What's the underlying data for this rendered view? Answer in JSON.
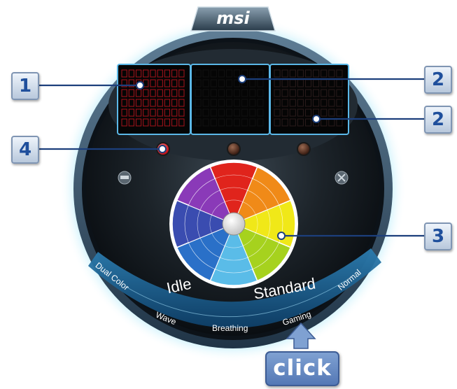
{
  "header": {
    "logo_text": "msi"
  },
  "keyboard_panels": [
    {
      "name": "left",
      "color": "#a8141c"
    },
    {
      "name": "middle",
      "color": "#111111"
    },
    {
      "name": "right",
      "color": "#2a1c1c"
    }
  ],
  "zone_indicators": [
    {
      "color": "#e5141c",
      "state": "active"
    },
    {
      "color": "#5a3020",
      "state": "inactive"
    },
    {
      "color": "#5a3020",
      "state": "inactive"
    }
  ],
  "side_icons": {
    "left": "keyboard-icon",
    "right": "close-icon"
  },
  "color_wheel": {
    "colors": [
      "#e0241c",
      "#f08a18",
      "#f0e818",
      "#a6d21e",
      "#5abce8",
      "#2a70c8",
      "#3a4cb0",
      "#8a3ab8"
    ]
  },
  "modes": {
    "primary": [
      "Idle",
      "Standard"
    ],
    "secondary": [
      "Dual Color",
      "Wave",
      "Breathing",
      "Gaming",
      "Normal"
    ]
  },
  "callouts": [
    "1",
    "2",
    "2",
    "3",
    "4"
  ],
  "click_hint": {
    "label": "click"
  }
}
